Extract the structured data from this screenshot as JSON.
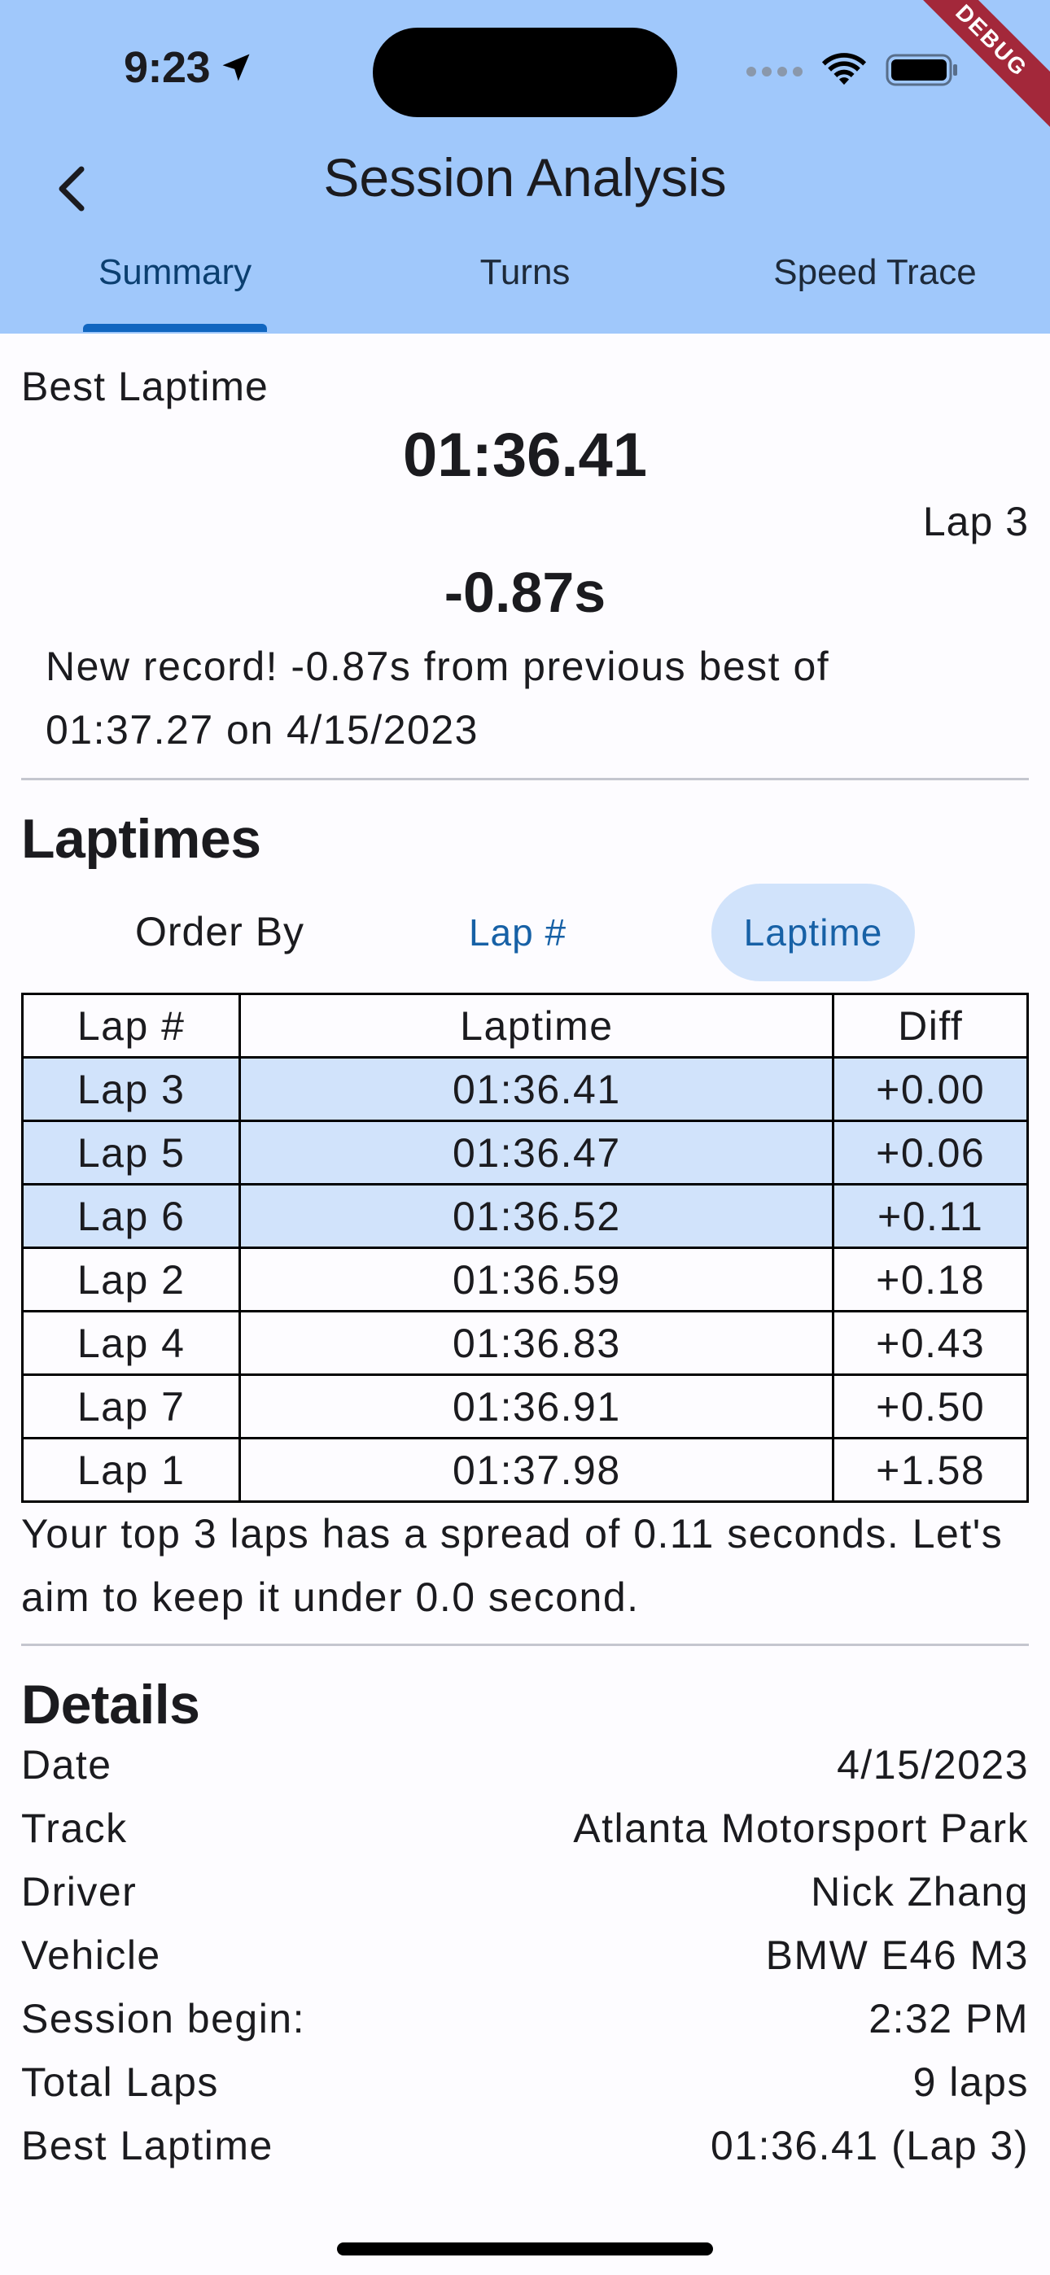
{
  "status_bar": {
    "time": "9:23"
  },
  "debug_banner": "DEBUG",
  "appbar": {
    "title": "Session Analysis",
    "tabs": [
      {
        "label": "Summary",
        "active": true
      },
      {
        "label": "Turns",
        "active": false
      },
      {
        "label": "Speed Trace",
        "active": false
      }
    ],
    "background_color": "#a0c8fb",
    "indicator_color": "#1166c0"
  },
  "best": {
    "label": "Best Laptime",
    "time": "01:36.41",
    "lap": "Lap 3",
    "delta": "-0.87s",
    "record_message": "New record! -0.87s from previous best of 01:37.27 on 4/15/2023"
  },
  "laptimes": {
    "heading": "Laptimes",
    "order_by_label": "Order By",
    "order_options": [
      "Lap #",
      "Laptime"
    ],
    "selected_order": "Laptime",
    "columns": [
      "Lap #",
      "Laptime",
      "Diff"
    ],
    "rows": [
      {
        "lap": "Lap 3",
        "time": "01:36.41",
        "diff": "+0.00",
        "top3": true
      },
      {
        "lap": "Lap 5",
        "time": "01:36.47",
        "diff": "+0.06",
        "top3": true
      },
      {
        "lap": "Lap 6",
        "time": "01:36.52",
        "diff": "+0.11",
        "top3": true
      },
      {
        "lap": "Lap 2",
        "time": "01:36.59",
        "diff": "+0.18",
        "top3": false
      },
      {
        "lap": "Lap 4",
        "time": "01:36.83",
        "diff": "+0.43",
        "top3": false
      },
      {
        "lap": "Lap 7",
        "time": "01:36.91",
        "diff": "+0.50",
        "top3": false
      },
      {
        "lap": "Lap 1",
        "time": "01:37.98",
        "diff": "+1.58",
        "top3": false
      }
    ],
    "highlight_color": "#d1e3fb",
    "spread_message": "Your top 3 laps has a spread of 0.11 seconds. Let's aim to keep it under 0.0 second."
  },
  "details": {
    "heading": "Details",
    "rows": [
      {
        "label": "Date",
        "value": "4/15/2023"
      },
      {
        "label": "Track",
        "value": "Atlanta Motorsport Park"
      },
      {
        "label": "Driver",
        "value": "Nick Zhang"
      },
      {
        "label": "Vehicle",
        "value": "BMW E46 M3"
      },
      {
        "label": "Session begin:",
        "value": "2:32 PM"
      },
      {
        "label": "Total Laps",
        "value": "9 laps"
      },
      {
        "label": "Best Laptime",
        "value": "01:36.41 (Lap 3)"
      }
    ]
  }
}
